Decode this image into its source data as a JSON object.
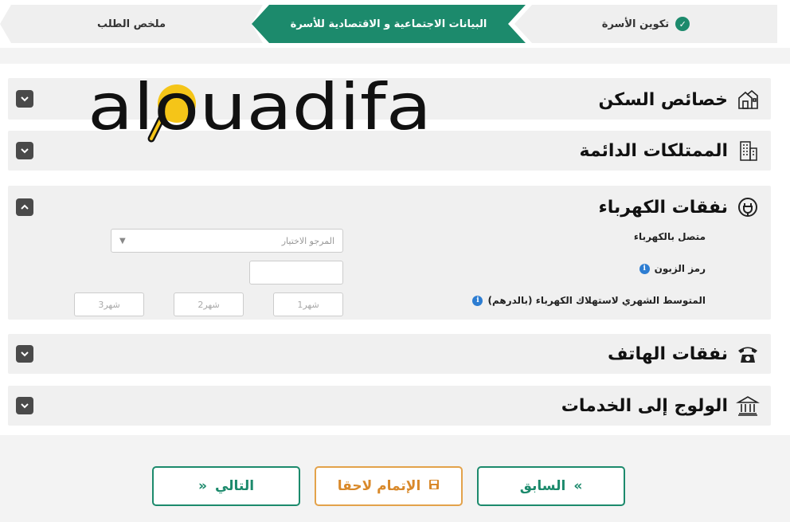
{
  "stepper": {
    "summary": "ملخص الطلب",
    "social": "البيانات الاجتماعية و الاقتصادية للأسرة",
    "family": "تكوين الأسرة"
  },
  "sections": {
    "housing": {
      "title": "خصائص السكن",
      "icon": "house-icon",
      "expanded": false
    },
    "property": {
      "title": "الممتلكات الدائمة",
      "icon": "building-icon",
      "expanded": false
    },
    "electricity": {
      "title": "نفقات الكهرباء",
      "icon": "plug-icon",
      "expanded": true,
      "connected_label": "متصل بالكهرباء",
      "connected_placeholder": "المرجو الاختيار",
      "customer_code_label": "رمز الزبون",
      "customer_code_value": "",
      "average_label": "المتوسط الشهري لاستهلاك الكهرباء (بالدرهم)",
      "months": [
        "شهر1",
        "شهر2",
        "شهر3"
      ]
    },
    "phone": {
      "title": "نفقات الهاتف",
      "icon": "phone-icon",
      "expanded": false
    },
    "services": {
      "title": "الولوج إلى الخدمات",
      "icon": "institution-icon",
      "expanded": false
    }
  },
  "buttons": {
    "prev": "السابق",
    "save": "الإتمام لاحقا",
    "next": "التالي"
  },
  "watermark": "alouadifa",
  "colors": {
    "primary": "#1c8a6c",
    "save": "#e3a24a",
    "watermark": "#f5c518"
  }
}
